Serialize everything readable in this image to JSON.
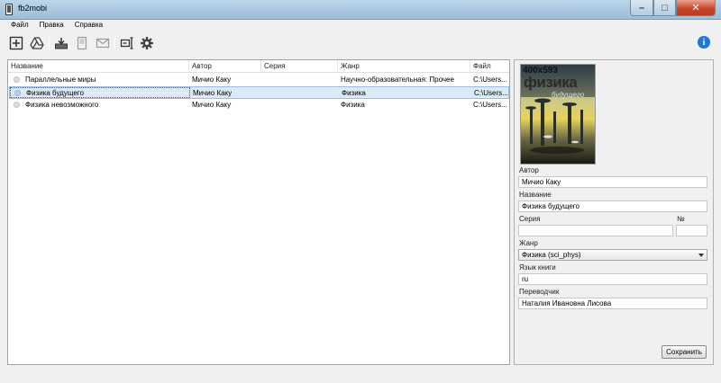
{
  "window": {
    "title": "fb2mobi"
  },
  "menu": {
    "items": [
      "Файл",
      "Правка",
      "Справка"
    ]
  },
  "toolbar": {
    "icons": [
      "add-icon",
      "google-drive-icon",
      "download-icon",
      "ebook-reader-icon",
      "mail-icon",
      "convert-icon",
      "gear-icon"
    ],
    "info_glyph": "i"
  },
  "table": {
    "columns": [
      "Название",
      "Автор",
      "Серия",
      "Жанр",
      "Файл"
    ],
    "rows": [
      {
        "title": "Параллельные миры",
        "author": "Мичио Каку",
        "series": "",
        "genre": "Научно-образовательная: Прочее",
        "file": "C:\\Users..."
      },
      {
        "title": "Физика будущего",
        "author": "Мичио Каку",
        "series": "",
        "genre": "Физика",
        "file": "C:\\Users..."
      },
      {
        "title": "Физика невозможного",
        "author": "Мичио Каку",
        "series": "",
        "genre": "Физика",
        "file": "C:\\Users..."
      }
    ]
  },
  "details": {
    "cover": {
      "size_text": "400x593",
      "cover_title": "физика",
      "cover_subtitle": "будущего"
    },
    "author_label": "Автор",
    "author_value": "Мичио Каку",
    "title_label": "Название",
    "title_value": "Физика будущего",
    "series_label": "Серия",
    "series_value": "",
    "number_label": "№",
    "number_value": "",
    "genre_label": "Жанр",
    "genre_value": "Физика (sci_phys)",
    "language_label": "Язык книги",
    "language_value": "ru",
    "translator_label": "Переводчик",
    "translator_value": "Наталия Ивановна Лисова",
    "save_label": "Сохранить"
  }
}
